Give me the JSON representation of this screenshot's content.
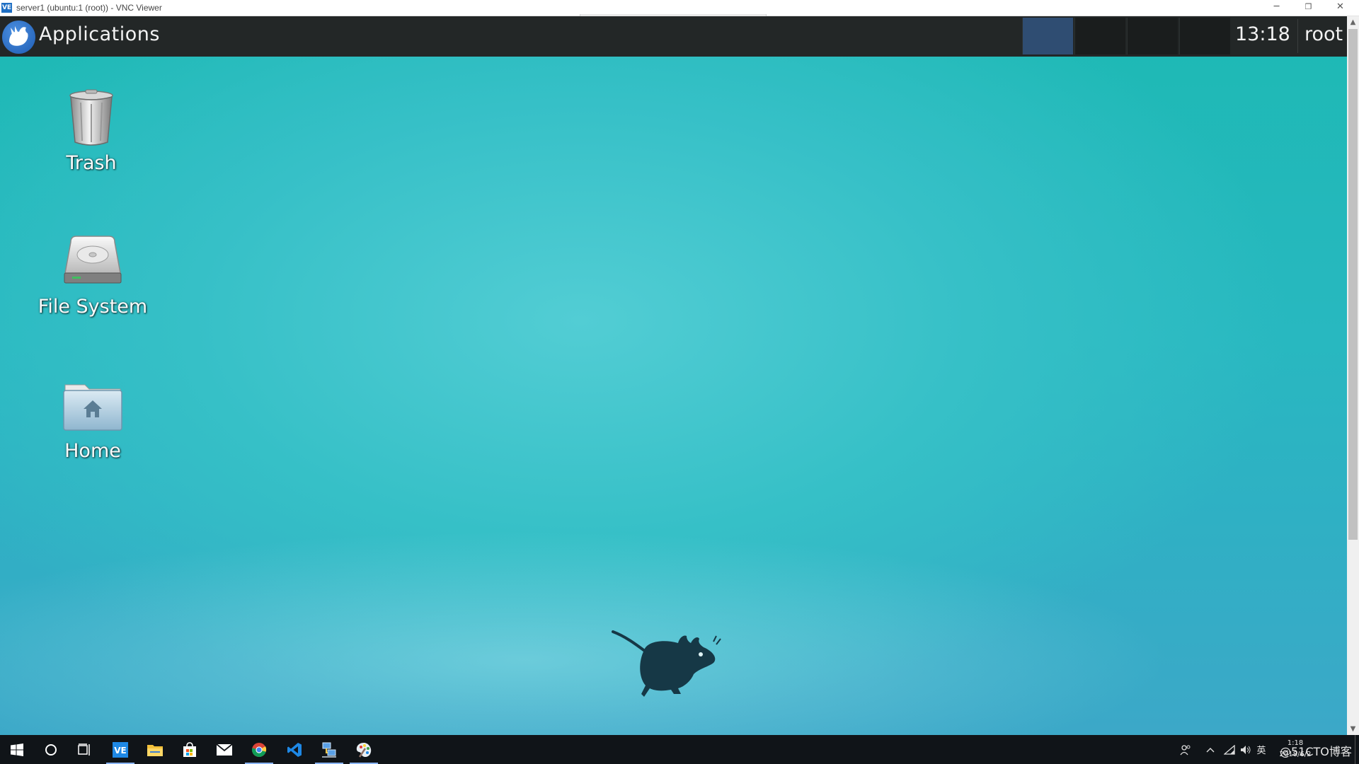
{
  "window": {
    "title": "server1 (ubuntu:1 (root)) - VNC Viewer",
    "logo_text": "VE",
    "controls": {
      "minimize": "─",
      "restore": "❐",
      "close": "✕"
    }
  },
  "panel": {
    "menu_label": "Applications",
    "workspaces": 4,
    "active_workspace": 1,
    "clock": "13:18",
    "user": "root"
  },
  "desktop": {
    "icons": [
      {
        "label": "Trash",
        "icon": "trash-icon"
      },
      {
        "label": "File System",
        "icon": "hard-drive-icon"
      },
      {
        "label": "Home",
        "icon": "home-folder-icon"
      }
    ],
    "wallpaper": "xfce-mouse-logo"
  },
  "scrollbar": {
    "up": "▲",
    "down": "▼"
  },
  "taskbar": {
    "apps": [
      {
        "name": "windows-start",
        "icon": "windows-logo-icon"
      },
      {
        "name": "cortana-search",
        "icon": "search-circle-icon"
      },
      {
        "name": "task-view",
        "icon": "task-view-icon"
      },
      {
        "name": "vnc-viewer",
        "icon": "vnc-icon",
        "active": true
      },
      {
        "name": "file-explorer",
        "icon": "folder-icon"
      },
      {
        "name": "microsoft-store",
        "icon": "store-bag-icon"
      },
      {
        "name": "mail",
        "icon": "mail-icon"
      },
      {
        "name": "chrome",
        "icon": "chrome-icon",
        "active": true
      },
      {
        "name": "vscode",
        "icon": "vscode-icon"
      },
      {
        "name": "remote-connection",
        "icon": "network-connection-icon",
        "active": true
      },
      {
        "name": "paint",
        "icon": "paint-palette-icon",
        "active": true
      }
    ],
    "tray": {
      "ime": "英",
      "clock_time": "1:18",
      "clock_date": "2018/6/2",
      "watermark": "@51CTO博客"
    }
  },
  "colors": {
    "panel_bg": "#232727",
    "active_workspace": "#2f4d72",
    "wallpaper_top": "#1db9b4",
    "wallpaper_mid": "#52cdd4",
    "taskbar_bg": "#101418",
    "accent": "#8ab4f8"
  }
}
